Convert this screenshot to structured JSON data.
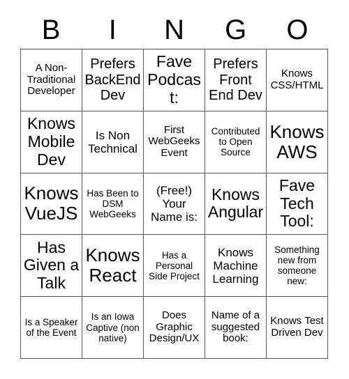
{
  "card": {
    "title": "BINGO",
    "header_letters": [
      "B",
      "I",
      "N",
      "G",
      "O"
    ],
    "grid_size": "5x5",
    "border_color": "#555555",
    "text_color": "#000000",
    "background_color": "#ffffff",
    "free_space_index": 12,
    "cells": [
      {
        "text": "A Non-Traditional Developer",
        "size": "fs-sm",
        "column": "B",
        "row": 1
      },
      {
        "text": "Prefers BackEnd Dev",
        "size": "fs-lg",
        "column": "I",
        "row": 1
      },
      {
        "text": "Fave Podcast:",
        "size": "fs-xl",
        "column": "N",
        "row": 1
      },
      {
        "text": "Prefers Front End Dev",
        "size": "fs-lg",
        "column": "G",
        "row": 1
      },
      {
        "text": "Knows CSS/HTML",
        "size": "fs-sm",
        "column": "O",
        "row": 1
      },
      {
        "text": "Knows Mobile Dev",
        "size": "fs-xl",
        "column": "B",
        "row": 2
      },
      {
        "text": "Is Non Technical",
        "size": "fs-md",
        "column": "I",
        "row": 2
      },
      {
        "text": "First WebGeeks Event",
        "size": "fs-sm",
        "column": "N",
        "row": 2
      },
      {
        "text": "Contributed to Open Source",
        "size": "fs-xs",
        "column": "G",
        "row": 2
      },
      {
        "text": "Knows AWS",
        "size": "fs-xxl",
        "column": "O",
        "row": 2
      },
      {
        "text": "Knows VueJS",
        "size": "fs-xxl",
        "column": "B",
        "row": 3
      },
      {
        "text": "Has Been to DSM WebGeeks",
        "size": "fs-xs",
        "column": "I",
        "row": 3
      },
      {
        "text": "(Free!) Your Name is:",
        "size": "fs-md",
        "column": "N",
        "row": 3
      },
      {
        "text": "Knows Angular",
        "size": "fs-xl",
        "column": "G",
        "row": 3
      },
      {
        "text": "Fave Tech Tool:",
        "size": "fs-xl",
        "column": "O",
        "row": 3
      },
      {
        "text": "Has Given a Talk",
        "size": "fs-xl",
        "column": "B",
        "row": 4
      },
      {
        "text": "Knows React",
        "size": "fs-xxl",
        "column": "I",
        "row": 4
      },
      {
        "text": "Has a Personal Side Project",
        "size": "fs-xs",
        "column": "N",
        "row": 4
      },
      {
        "text": "Knows Machine Learning",
        "size": "fs-md",
        "column": "G",
        "row": 4
      },
      {
        "text": "Something new from someone new:",
        "size": "fs-xs",
        "column": "O",
        "row": 4
      },
      {
        "text": "Is a Speaker of the Event",
        "size": "fs-xs",
        "column": "B",
        "row": 5
      },
      {
        "text": "Is an Iowa Captive (non native)",
        "size": "fs-xs",
        "column": "I",
        "row": 5
      },
      {
        "text": "Does Graphic Design/UX",
        "size": "fs-sm",
        "column": "N",
        "row": 5
      },
      {
        "text": "Name of a suggested book:",
        "size": "fs-sm",
        "column": "G",
        "row": 5
      },
      {
        "text": "Knows Test Driven Dev",
        "size": "fs-sm",
        "column": "O",
        "row": 5
      }
    ]
  }
}
